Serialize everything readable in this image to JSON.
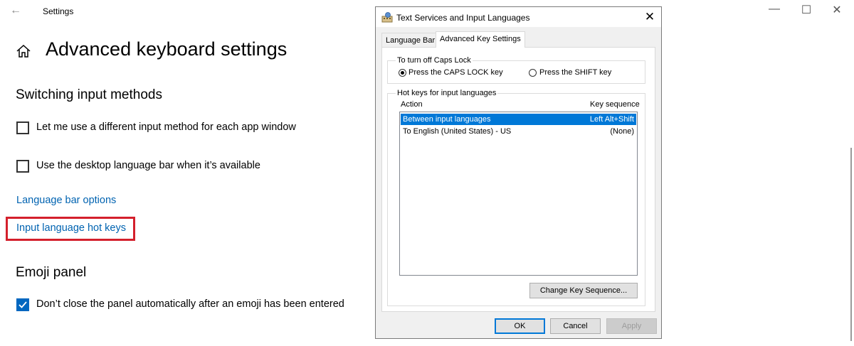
{
  "settings": {
    "app_title": "Settings",
    "page_title": "Advanced keyboard settings",
    "switching": {
      "heading": "Switching input methods",
      "option1": "Let me use a different input method for each app window",
      "option2": "Use the desktop language bar when it’s available",
      "option1_checked": false,
      "option2_checked": false
    },
    "links": {
      "language_bar_options": "Language bar options",
      "input_language_hot_keys": "Input language hot keys"
    },
    "emoji": {
      "heading": "Emoji panel",
      "option": "Don’t close the panel automatically after an emoji has been entered",
      "option_checked": true
    },
    "window_controls": {
      "minimize": "—",
      "maximize": "☐",
      "close": "✕"
    }
  },
  "dialog": {
    "title": "Text Services and Input Languages",
    "close": "✕",
    "tabs": [
      "Language Bar",
      "Advanced Key Settings"
    ],
    "active_tab": "Advanced Key Settings",
    "caps_lock": {
      "legend": "To turn off Caps Lock",
      "option1": "Press the CAPS LOCK key",
      "option2": "Press the SHIFT key",
      "selected": "Press the CAPS LOCK key"
    },
    "hotkeys": {
      "legend": "Hot keys for input languages",
      "col_action": "Action",
      "col_key": "Key sequence",
      "rows": [
        {
          "action": "Between input languages",
          "key": "Left Alt+Shift",
          "selected": true
        },
        {
          "action": "To English (United States) - US",
          "key": "(None)",
          "selected": false
        }
      ],
      "change_button": "Change Key Sequence..."
    },
    "buttons": {
      "ok": "OK",
      "cancel": "Cancel",
      "apply": "Apply"
    }
  },
  "colors": {
    "link": "#0063b1",
    "highlight": "#d4202c",
    "checkbox_checked": "#0067c0",
    "list_selection": "#0078d7"
  }
}
